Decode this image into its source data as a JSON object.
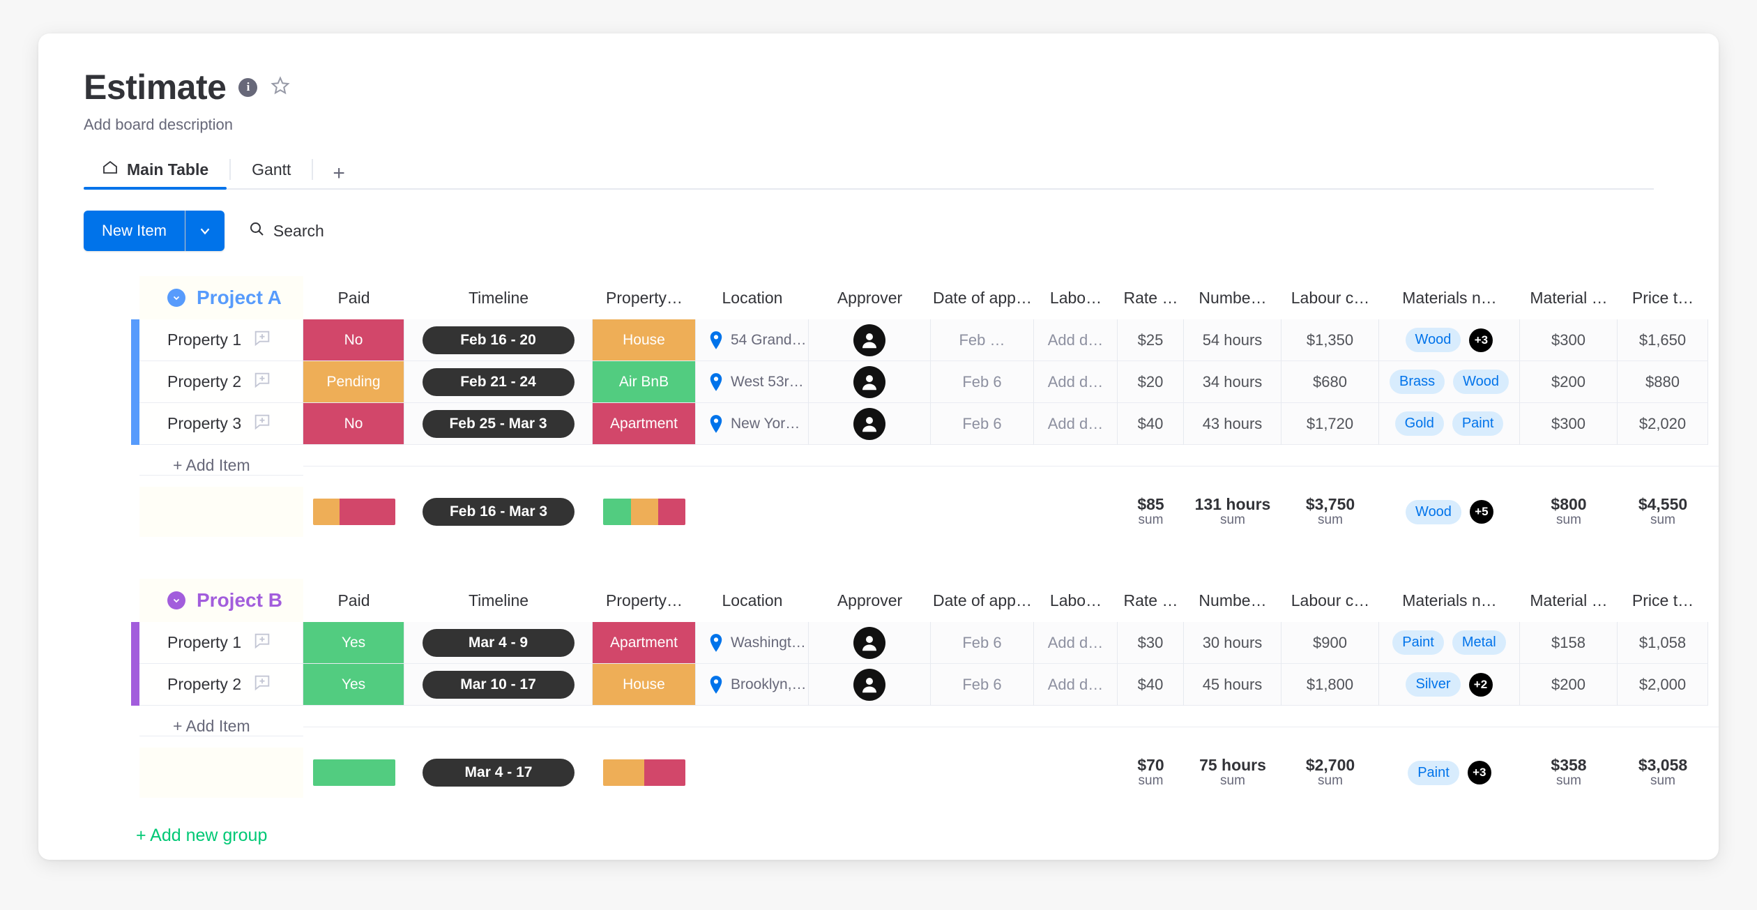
{
  "board": {
    "title": "Estimate",
    "description": "Add board description",
    "info_icon": "info-icon",
    "star_icon": "star-icon",
    "tabs": [
      {
        "label": "Main Table",
        "icon": "home-icon",
        "active": true
      },
      {
        "label": "Gantt",
        "icon": "",
        "active": false
      }
    ],
    "add_tab_label": "+"
  },
  "toolbar": {
    "new_item_label": "New Item",
    "new_item_caret": "chevron-down-icon",
    "search_label": "Search",
    "search_icon": "search-icon"
  },
  "colors": {
    "accent_blue": "#0073ea",
    "group_a": "#579bfc",
    "group_b": "#a25ddc",
    "status_red": "#d2476a",
    "status_orange": "#eeae57",
    "status_green": "#52cc80",
    "tag_bg": "#d8ecfd",
    "tag_text": "#0073ea",
    "pill_bg": "#333333",
    "add_group_green": "#00c875"
  },
  "columns": [
    {
      "key": "name",
      "label": ""
    },
    {
      "key": "paid",
      "label": "Paid"
    },
    {
      "key": "timeline",
      "label": "Timeline"
    },
    {
      "key": "ptype",
      "label": "Property…"
    },
    {
      "key": "location",
      "label": "Location"
    },
    {
      "key": "approver",
      "label": "Approver"
    },
    {
      "key": "date",
      "label": "Date of app…"
    },
    {
      "key": "labour",
      "label": "Labo…"
    },
    {
      "key": "rate",
      "label": "Rate …"
    },
    {
      "key": "number",
      "label": "Numbe…"
    },
    {
      "key": "lcost",
      "label": "Labour c…"
    },
    {
      "key": "materials",
      "label": "Materials n…"
    },
    {
      "key": "mcost",
      "label": "Material …"
    },
    {
      "key": "price",
      "label": "Price t…"
    }
  ],
  "groups": [
    {
      "name": "Project A",
      "color": "#579bfc",
      "collapse_icon": "chevron-down-icon",
      "add_item_label": "+ Add Item",
      "rows": [
        {
          "name": "Property 1",
          "paid": {
            "text": "No",
            "color": "#d2476a"
          },
          "timeline": "Feb 16 - 20",
          "ptype": {
            "text": "House",
            "color": "#eeae57"
          },
          "location": "54 Grand…",
          "approver_icon": "person-avatar",
          "date": "Feb …",
          "labour": "Add d…",
          "rate": "$25",
          "number": "54 hours",
          "lcost": "$1,350",
          "materials": [
            "Wood"
          ],
          "materials_more": "+3",
          "mcost": "$300",
          "price": "$1,650"
        },
        {
          "name": "Property 2",
          "paid": {
            "text": "Pending",
            "color": "#eeae57"
          },
          "timeline": "Feb 21 - 24",
          "ptype": {
            "text": "Air BnB",
            "color": "#52cc80"
          },
          "location": "West 53r…",
          "approver_icon": "person-avatar",
          "date": "Feb 6",
          "labour": "Add d…",
          "rate": "$20",
          "number": "34 hours",
          "lcost": "$680",
          "materials": [
            "Brass",
            "Wood"
          ],
          "materials_more": "",
          "mcost": "$200",
          "price": "$880"
        },
        {
          "name": "Property 3",
          "paid": {
            "text": "No",
            "color": "#d2476a"
          },
          "timeline": "Feb 25 - Mar 3",
          "ptype": {
            "text": "Apartment",
            "color": "#d2476a"
          },
          "location": "New Yor…",
          "approver_icon": "person-avatar",
          "date": "Feb 6",
          "labour": "Add d…",
          "rate": "$40",
          "number": "43 hours",
          "lcost": "$1,720",
          "materials": [
            "Gold",
            "Paint"
          ],
          "materials_more": "",
          "mcost": "$300",
          "price": "$2,020"
        }
      ],
      "summary": {
        "paid_bar": [
          {
            "color": "#eeae57",
            "pct": 33
          },
          {
            "color": "#d2476a",
            "pct": 67
          }
        ],
        "timeline": "Feb 16 - Mar 3",
        "ptype_bar": [
          {
            "color": "#52cc80",
            "pct": 34
          },
          {
            "color": "#eeae57",
            "pct": 33
          },
          {
            "color": "#d2476a",
            "pct": 33
          }
        ],
        "rate": {
          "value": "$85",
          "label": "sum"
        },
        "number": {
          "value": "131 hours",
          "label": "sum"
        },
        "lcost": {
          "value": "$3,750",
          "label": "sum"
        },
        "materials": [
          "Wood"
        ],
        "materials_more": "+5",
        "mcost": {
          "value": "$800",
          "label": "sum"
        },
        "price": {
          "value": "$4,550",
          "label": "sum"
        }
      }
    },
    {
      "name": "Project B",
      "color": "#a25ddc",
      "collapse_icon": "chevron-down-icon",
      "add_item_label": "+ Add Item",
      "rows": [
        {
          "name": "Property 1",
          "paid": {
            "text": "Yes",
            "color": "#52cc80"
          },
          "timeline": "Mar 4 - 9",
          "ptype": {
            "text": "Apartment",
            "color": "#d2476a"
          },
          "location": "Washingt…",
          "approver_icon": "person-avatar",
          "date": "Feb 6",
          "labour": "Add d…",
          "rate": "$30",
          "number": "30 hours",
          "lcost": "$900",
          "materials": [
            "Paint",
            "Metal"
          ],
          "materials_more": "",
          "mcost": "$158",
          "price": "$1,058"
        },
        {
          "name": "Property 2",
          "paid": {
            "text": "Yes",
            "color": "#52cc80"
          },
          "timeline": "Mar 10 - 17",
          "ptype": {
            "text": "House",
            "color": "#eeae57"
          },
          "location": "Brooklyn,…",
          "approver_icon": "person-avatar",
          "date": "Feb 6",
          "labour": "Add d…",
          "rate": "$40",
          "number": "45 hours",
          "lcost": "$1,800",
          "materials": [
            "Silver"
          ],
          "materials_more": "+2",
          "mcost": "$200",
          "price": "$2,000"
        }
      ],
      "summary": {
        "paid_bar": [
          {
            "color": "#52cc80",
            "pct": 100
          }
        ],
        "timeline": "Mar 4 - 17",
        "ptype_bar": [
          {
            "color": "#eeae57",
            "pct": 50
          },
          {
            "color": "#d2476a",
            "pct": 50
          }
        ],
        "rate": {
          "value": "$70",
          "label": "sum"
        },
        "number": {
          "value": "75 hours",
          "label": "sum"
        },
        "lcost": {
          "value": "$2,700",
          "label": "sum"
        },
        "materials": [
          "Paint"
        ],
        "materials_more": "+3",
        "mcost": {
          "value": "$358",
          "label": "sum"
        },
        "price": {
          "value": "$3,058",
          "label": "sum"
        }
      }
    }
  ],
  "add_group_label": "+ Add new group"
}
